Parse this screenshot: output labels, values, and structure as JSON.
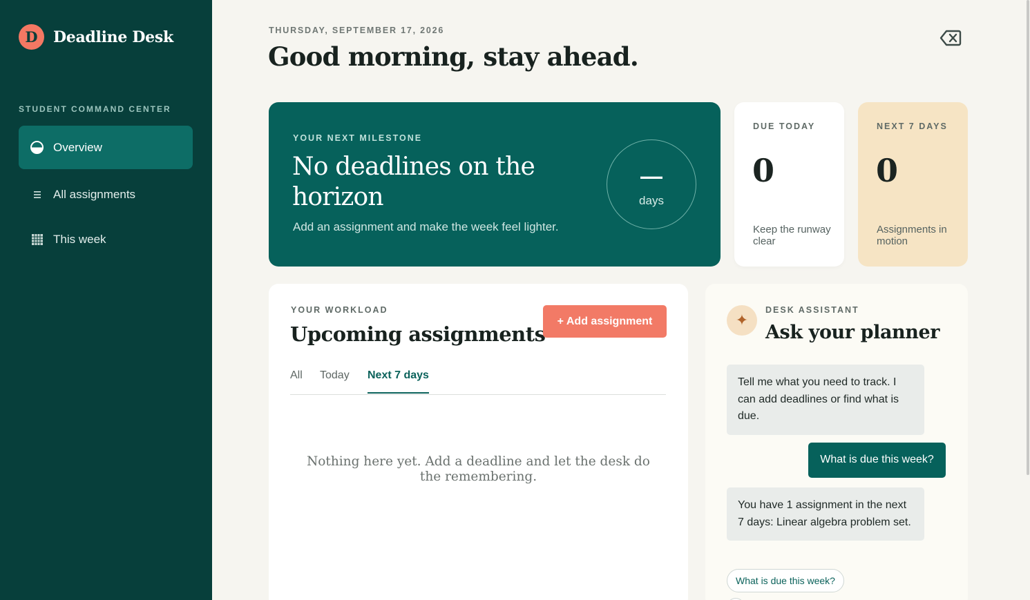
{
  "app": {
    "logo_letter": "D",
    "name": "Deadline Desk"
  },
  "sidebar": {
    "heading": "STUDENT COMMAND CENTER",
    "items": [
      {
        "label": "Overview",
        "icon": "overview-icon",
        "active": true
      },
      {
        "label": "All assignments",
        "icon": "list-icon",
        "active": false
      },
      {
        "label": "This week",
        "icon": "calendar-grid-icon",
        "active": false
      }
    ]
  },
  "header": {
    "date": "THURSDAY, SEPTEMBER 17, 2026",
    "greeting": "Good morning, stay ahead."
  },
  "milestone": {
    "eyebrow": "YOUR NEXT MILESTONE",
    "title": "No deadlines on the horizon",
    "subtitle": "Add an assignment and make the week feel lighter.",
    "days_value": "—",
    "days_label": "days"
  },
  "stats": {
    "due_today": {
      "label": "DUE TODAY",
      "value": "0",
      "caption": "Keep the runway clear"
    },
    "next_7_days": {
      "label": "NEXT 7 DAYS",
      "value": "0",
      "caption": "Assignments in motion"
    }
  },
  "workload": {
    "eyebrow": "YOUR WORKLOAD",
    "title": "Upcoming assignments",
    "add_button": "+ Add assignment",
    "tabs": [
      {
        "label": "All",
        "active": false
      },
      {
        "label": "Today",
        "active": false
      },
      {
        "label": "Next 7 days",
        "active": true
      }
    ],
    "empty_message": "Nothing here yet. Add a deadline and let the desk do the remembering."
  },
  "assistant": {
    "eyebrow": "DESK ASSISTANT",
    "title": "Ask your planner",
    "messages": [
      {
        "role": "assistant",
        "text": "Tell me what you need to track. I can add deadlines or find what is due."
      },
      {
        "role": "user",
        "text": "What is due this week?"
      },
      {
        "role": "assistant",
        "text": "You have 1 assignment in the next 7 days: Linear algebra problem set."
      }
    ],
    "suggestions": [
      "What is due this week?"
    ]
  },
  "colors": {
    "sidebar_bg": "#073f3b",
    "accent_teal": "#06615b",
    "accent_coral": "#f27a66",
    "highlight_sand": "#f6e4c4"
  }
}
